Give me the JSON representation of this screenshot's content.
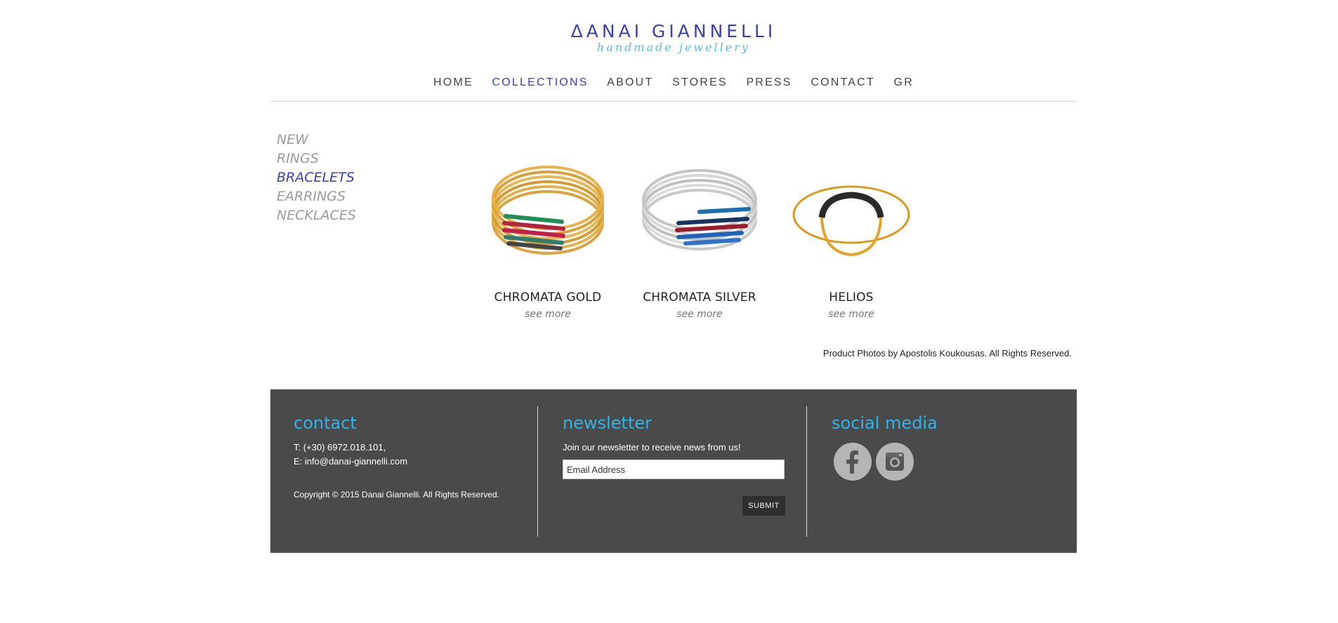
{
  "brand": {
    "name": "ΔANAI GIANNELLI",
    "tagline": "handmade jewellery"
  },
  "nav": [
    {
      "label": "HOME"
    },
    {
      "label": "COLLECTIONS",
      "active": true
    },
    {
      "label": "ABOUT"
    },
    {
      "label": "STORES"
    },
    {
      "label": "PRESS"
    },
    {
      "label": "CONTACT"
    },
    {
      "label": "GR"
    }
  ],
  "categories": [
    {
      "label": "NEW"
    },
    {
      "label": "RINGS"
    },
    {
      "label": "BRACELETS",
      "active": true
    },
    {
      "label": "EARRINGS"
    },
    {
      "label": "NECKLACES"
    }
  ],
  "products": [
    {
      "name": "CHROMATA GOLD",
      "more": "see more"
    },
    {
      "name": "CHROMATA SILVER",
      "more": "see more"
    },
    {
      "name": "HELIOS",
      "more": "see more"
    }
  ],
  "credits": "Product Photos by Apostolis Koukousas. All Rights Reserved.",
  "footer": {
    "contact": {
      "title": "contact",
      "phone": "T: (+30) 6972.018.101,",
      "email": "E: info@danai-giannelli.com",
      "copyright": "Copyright © 2015 Danai Giannelli. All Rights Reserved."
    },
    "newsletter": {
      "title": "newsletter",
      "text": "Join our newsletter to receive news from us!",
      "placeholder": "Email Address",
      "submit": "SUBMIT"
    },
    "social": {
      "title": "social media",
      "icons": [
        "facebook-icon",
        "instagram-icon"
      ]
    }
  },
  "colors": {
    "brand": "#3b3fb4",
    "accent": "#2fb3e8",
    "footer_bg": "#4a4a4a"
  }
}
